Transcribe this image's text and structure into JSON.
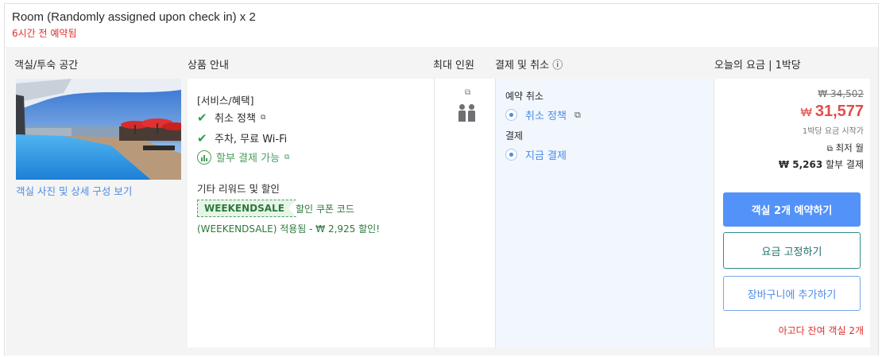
{
  "room": {
    "title": "Room (Randomly assigned upon check in) x 2",
    "booked_note": "6시간 전 예약됨",
    "photo_link": "객실 사진 및 상세 구성 보기"
  },
  "headers": {
    "room_type": "객실/투숙 공간",
    "product_info": "상품 안내",
    "max_occupancy": "최대 인원",
    "payment_cancel": "결제 및 취소 ⓘ",
    "today_price": "오늘의 요금 | 1박당"
  },
  "benefits": {
    "heading": "[서비스/혜택]",
    "items": [
      {
        "label": "취소 정책",
        "icon": "check-icon"
      },
      {
        "label": "주차, 무료 Wi-Fi",
        "icon": "check-icon"
      },
      {
        "label": "할부 결제 가능",
        "icon": "installment-icon"
      }
    ],
    "rewards_heading": "기타 리워드 및 할인",
    "coupon_code": "WEEKENDSALE",
    "coupon_label": "할인 쿠폰 코드",
    "applied_text": "(WEEKENDSALE) 적용됨 - ₩ 2,925 할인!"
  },
  "policy": {
    "cancel_heading": "예약 취소",
    "cancel_link": "취소 정책",
    "payment_heading": "결제",
    "payment_option": "지금 결제"
  },
  "pricing": {
    "original": "₩ 34,502",
    "currency": "₩",
    "price": "31,577",
    "per_night_note": "1박당 요금 시작가",
    "lowest_label": "최저 월",
    "installment_amount": "₩ 5,263",
    "installment_label": "할부 결제"
  },
  "actions": {
    "book": "객실 2개 예약하기",
    "lock": "요금 고정하기",
    "cart": "장바구니에 추가하기"
  },
  "availability": "아고다 잔여 객실 2개"
}
